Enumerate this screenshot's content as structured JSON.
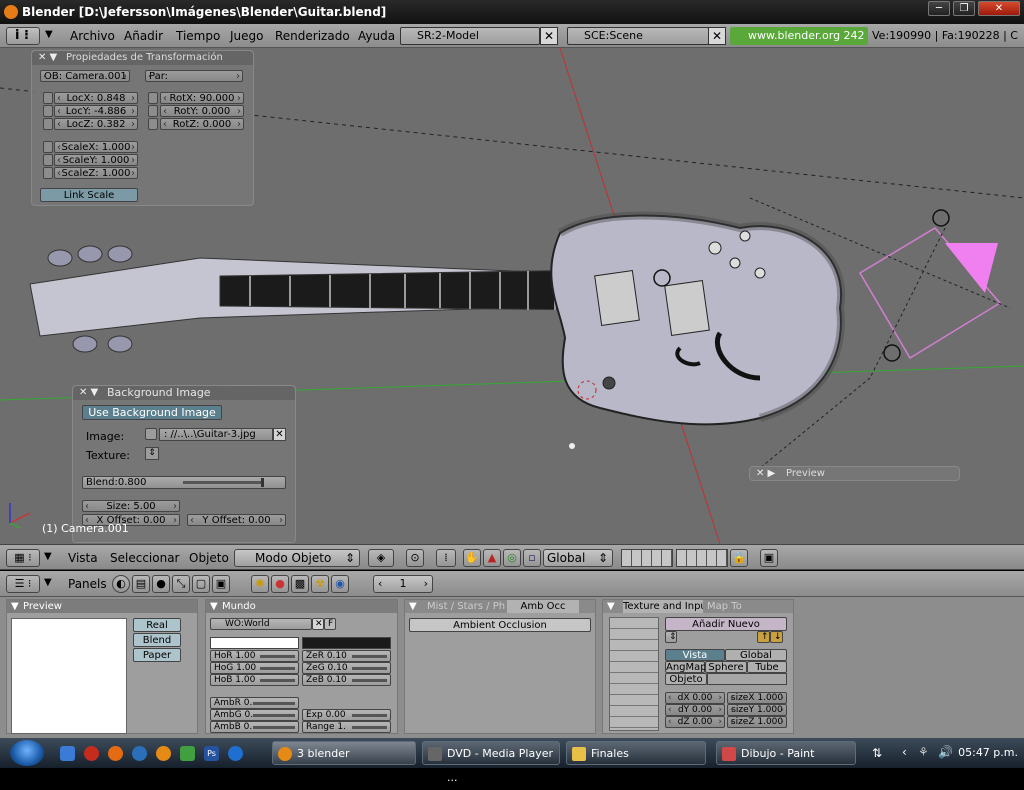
{
  "window": {
    "title": "Blender [D:\\Jefersson\\Imágenes\\Blender\\Guitar.blend]"
  },
  "menubar": {
    "items": [
      "Archivo",
      "Añadir",
      "Tiempo",
      "Juego",
      "Renderizado",
      "Ayuda"
    ],
    "screen": "SR:2-Model",
    "scene": "SCE:Scene",
    "url": "www.blender.org 242",
    "stats": "Ve:190990 | Fa:190228 | C"
  },
  "transform_panel": {
    "title": "Propiedades de Transformación",
    "ob": "OB: Camera.001",
    "par": "Par:",
    "loc": [
      "LocX: 0.848",
      "LocY: -4.886",
      "LocZ: 0.382"
    ],
    "rot": [
      "RotX: 90.000",
      "RotY: 0.000",
      "RotZ: 0.000"
    ],
    "scale": [
      "ScaleX: 1.000",
      "ScaleY: 1.000",
      "ScaleZ: 1.000"
    ],
    "link_scale": "Link Scale"
  },
  "background_panel": {
    "title": "Background Image",
    "use_btn": "Use Background Image",
    "image_label": "Image:",
    "image_path": ": //..\\..\\Guitar-3.jpg",
    "texture_label": "Texture:",
    "blend": "Blend:0.800",
    "blend_value": 0.8,
    "size": "Size: 5.00",
    "x_offset": "X Offset: 0.00",
    "y_offset": "Y Offset: 0.00"
  },
  "preview_floating": {
    "title": "Preview"
  },
  "viewport": {
    "object_label": "(1) Camera.001"
  },
  "view_header": {
    "menus": [
      "Vista",
      "Seleccionar",
      "Objeto"
    ],
    "mode": "Modo Objeto",
    "orientation": "Global"
  },
  "buttons_header": {
    "panels_label": "Panels",
    "frame": "1"
  },
  "preview_panel": {
    "title": "Preview",
    "buttons": [
      "Real",
      "Blend",
      "Paper"
    ]
  },
  "mundo_panel": {
    "title": "Mundo",
    "wo": "WO:World",
    "f": "F",
    "hor": [
      "HoR 1.00",
      "HoG 1.00",
      "HoB 1.00"
    ],
    "zer": [
      "ZeR 0.10",
      "ZeG 0.10",
      "ZeB 0.10"
    ],
    "amb": [
      "AmbR 0.",
      "AmbG 0.",
      "AmbB 0."
    ],
    "exp": "Exp 0.00",
    "range": "Range 1."
  },
  "mist_panel": {
    "tabs": [
      "Mist / Stars / Ph",
      "Amb Occ"
    ],
    "button": "Ambient Occlusion"
  },
  "texture_panel": {
    "tabs": [
      "Texture and Inpu",
      "Map To"
    ],
    "add_new": "Añadir Nuevo",
    "vista": "Vista",
    "global": "Global",
    "angmap": "AngMap",
    "sphere": "Sphere",
    "tube": "Tube",
    "objeto": "Objeto",
    "d": [
      "dX 0.00",
      "dY 0.00",
      "dZ 0.00"
    ],
    "size": [
      "sizeX 1.000",
      "sizeY 1.000",
      "sizeZ 1.000"
    ]
  },
  "taskbar": {
    "items": [
      "3 blender",
      "DVD - Media Player ...",
      "Finales",
      "Dibujo - Paint"
    ],
    "clock": "05:47 p.m."
  }
}
